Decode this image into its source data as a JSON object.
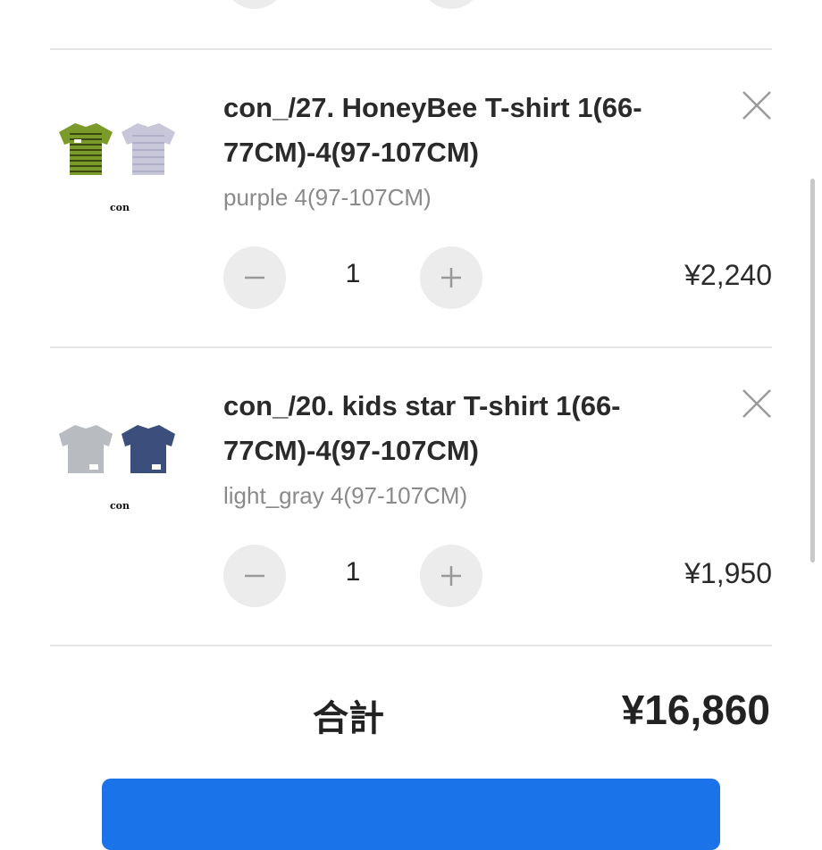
{
  "items": [
    {
      "title": "con_/27. HoneyBee T-shirt 1(66-77CM)-4(97-107CM)",
      "variant": "purple 4(97-107CM)",
      "quantity": "1",
      "price": "¥2,240",
      "brand_label": "con",
      "thumb_colors": [
        "#7a9a2a",
        "#c7c7d9"
      ]
    },
    {
      "title": "con_/20. kids star T-shirt 1(66-77CM)-4(97-107CM)",
      "variant": "light_gray 4(97-107CM)",
      "quantity": "1",
      "price": "¥1,950",
      "brand_label": "con",
      "thumb_colors": [
        "#b8bcc0",
        "#3c4f7c"
      ]
    }
  ],
  "total": {
    "label": "合計",
    "value": "¥16,860"
  },
  "colors": {
    "accent": "#1a73e8",
    "button_bg": "#ececec",
    "divider": "#e6e6e6"
  },
  "icons": {
    "remove": "close-icon",
    "decrease": "minus-icon",
    "increase": "plus-icon"
  }
}
